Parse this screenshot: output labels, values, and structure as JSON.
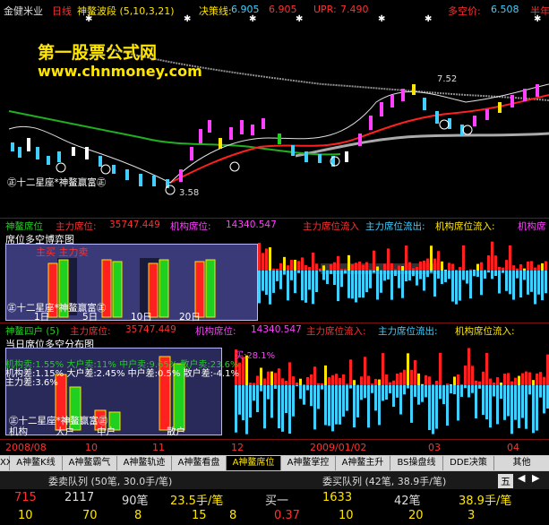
{
  "colors": {
    "red": "#ff2020",
    "cyan": "#40d0ff",
    "yellow": "#ffe600",
    "green": "#20d020",
    "magenta": "#ff40ff",
    "white": "#ffffff",
    "gray": "#909090"
  },
  "header": {
    "stock": "金健米业",
    "period": "日线",
    "indicator": "神鳌波段 (5,10,3,21)",
    "decision_label": "决策线:",
    "decision_value": "6.905",
    "value2": "6.905",
    "upr": "UPR:",
    "upr_value": "7.490",
    "multi_label": "多空价:",
    "multi_value": "6.508",
    "trail": "半年"
  },
  "watermark": {
    "title": "第一股票公式网",
    "url": "www.chnmoney.com"
  },
  "main_chart": {
    "price_high": "7.52",
    "price_low": "3.58",
    "caption": "㊣十二星座*神鳌赢富㊣"
  },
  "panel2": {
    "name": "神鳌席位",
    "main_label": "主力席位:",
    "main_value": "35747.449",
    "inst_label": "机构席位:",
    "inst_value": "14340.547",
    "flow_in": "主力席位流入",
    "flow_out": "主力席位流出:",
    "inst_in": "机构席位流入:",
    "inst_out": "机构席",
    "inset_title": "席位多空博弈图",
    "inset_legend": "主买  主力卖",
    "inset_caption": "㊣十二星座*神鳌赢富㊣",
    "periods": [
      "1日",
      "5日",
      "10日",
      "20日"
    ]
  },
  "panel3": {
    "name": "神鳌四户 (5)",
    "main_label": "主力席位:",
    "main_value": "35747.449",
    "inst_label": "机构席位:",
    "inst_value": "14340.547",
    "flow_in": "主力席位流入:",
    "flow_out": "主力席位流出:",
    "inst_in": "机构席位流入:",
    "inset_title": "当日席位多空分布图",
    "overlay_line": "机构卖:1.55% 大户卖:11% 中户卖:9.65% 散户卖:23.6%",
    "overlay_line2": "机构差:1.15% 大户差:2.45% 中户差:0.5% 散户差:-4.1%",
    "overlay_line3": "主力差:3.6%",
    "overlay_extra": "买:28.1%",
    "inset_caption": "㊣十二星座*神鳌赢富㊣",
    "buckets": [
      "机构",
      "大户",
      "中户",
      "散户"
    ]
  },
  "axis_dates": [
    "2008/08",
    "10",
    "11",
    "12",
    "2009/01/02",
    "03",
    "04"
  ],
  "tabs": [
    "XX",
    "A神鳌K线",
    "A神鳌霸气",
    "A神鳌轨迹",
    "A神鳌看盘",
    "A神鳌席位",
    "A神鳌掌控",
    "A神鳌主升",
    "BS操盘线",
    "DDE决策",
    "其他"
  ],
  "active_tab": "A神鳌席位",
  "queue": {
    "sell_queue": "委卖队列 (50笔, 30.0手/笔)",
    "buy_queue": "委买队列 (42笔, 38.9手/笔)",
    "right_tab": "五",
    "sell_count": "715",
    "sell_total": "2117",
    "sell_bi": "90笔",
    "sell_avg": "23.5手/笔",
    "buy_label": "买一",
    "buy_count": "1633",
    "buy_bi": "42笔",
    "buy_avg": "38.9手/笔",
    "row2": [
      "10",
      "70",
      "8",
      "15",
      "8",
      "0.37",
      "10",
      "20",
      "3"
    ]
  }
}
